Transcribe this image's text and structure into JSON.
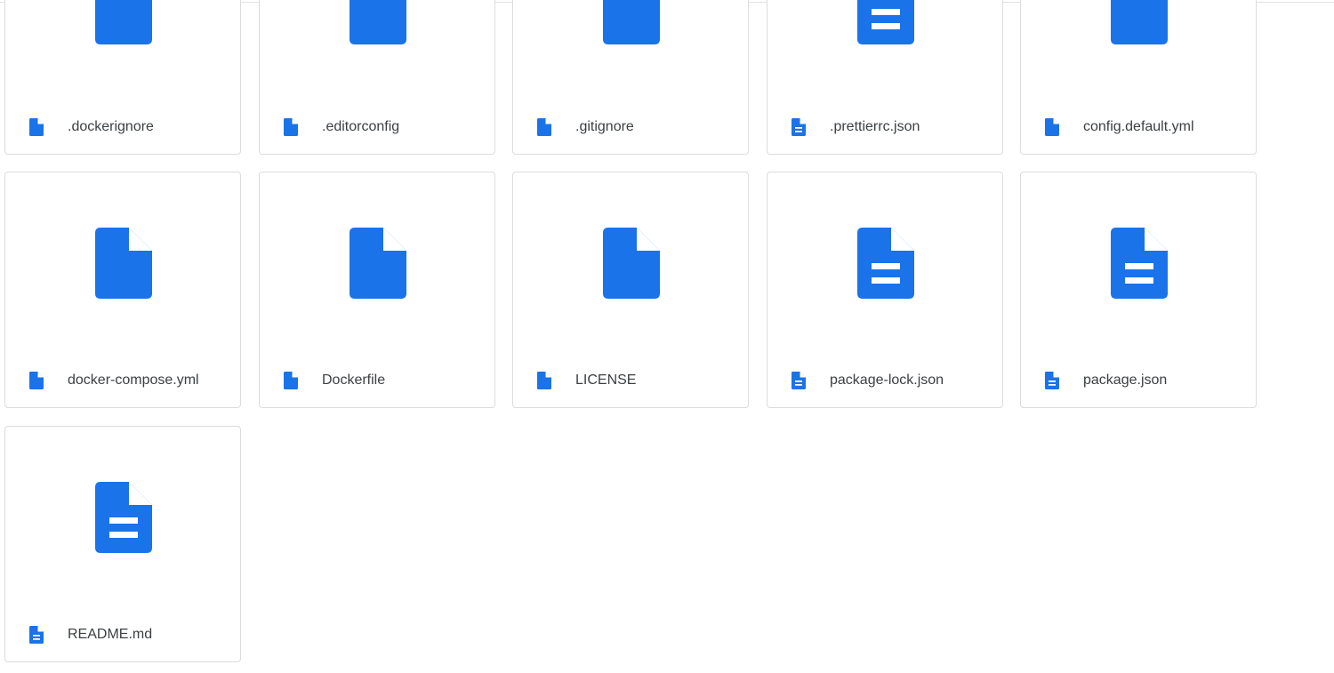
{
  "colors": {
    "file_icon": "#1a73e8",
    "card_border": "#dadce0",
    "text": "#3c4043"
  },
  "files": [
    {
      "name": ".dockerignore",
      "icon": "file-icon"
    },
    {
      "name": ".editorconfig",
      "icon": "file-icon"
    },
    {
      "name": ".gitignore",
      "icon": "file-icon"
    },
    {
      "name": ".prettierrc.json",
      "icon": "document-icon"
    },
    {
      "name": "config.default.yml",
      "icon": "file-icon"
    },
    {
      "name": "docker-compose.yml",
      "icon": "file-icon"
    },
    {
      "name": "Dockerfile",
      "icon": "file-icon"
    },
    {
      "name": "LICENSE",
      "icon": "file-icon"
    },
    {
      "name": "package-lock.json",
      "icon": "document-icon"
    },
    {
      "name": "package.json",
      "icon": "document-icon"
    },
    {
      "name": "README.md",
      "icon": "document-icon"
    }
  ]
}
